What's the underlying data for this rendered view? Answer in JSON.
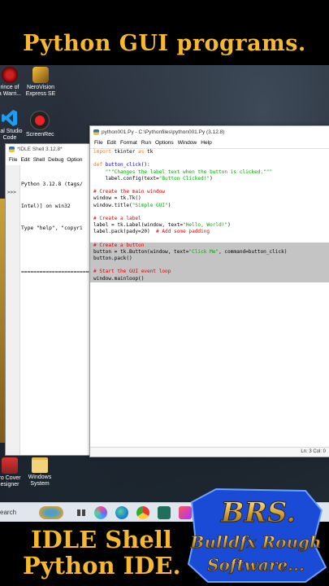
{
  "banner": {
    "top_title": "Python GUI programs.",
    "bottom_line1": "IDLE Shell",
    "bottom_line2": "Python IDE."
  },
  "desktop_icons": [
    {
      "label1": "rince of",
      "label2": "a Warri..."
    },
    {
      "label1": "NeroVision",
      "label2": "Express SE"
    },
    {
      "label1": "ual Studio",
      "label2": "Code"
    },
    {
      "label1": "ScreenRec",
      "label2": ""
    },
    {
      "label1": "ro Cover",
      "label2": "esigner"
    },
    {
      "label1": "Windows",
      "label2": "System"
    }
  ],
  "shell": {
    "title": "*IDLE Shell 3.12.8*",
    "menu": [
      "File",
      "Edit",
      "Shell",
      "Debug",
      "Option"
    ],
    "prompt": ">>>",
    "lines": [
      "Python 3.12.8 (tags/",
      "Intel)] on win32",
      "Type \"help\", \"copyri",
      "",
      "======================="
    ]
  },
  "editor": {
    "title": "python001.Py - C:\\Pythonfiles\\python001.Py (3.12.8)",
    "menu": [
      "File",
      "Edit",
      "Format",
      "Run",
      "Options",
      "Window",
      "Help"
    ],
    "status": "Ln: 3   Col: 0"
  },
  "taskbar": {
    "search_label": "earch"
  },
  "logo": {
    "text1": "BRS.",
    "text2": "Bulldfx Rough",
    "text3": "Software..."
  },
  "colors": {
    "headline": "#f5b82e",
    "keyword": "#ff7700",
    "string": "#00aa00",
    "comment": "#dd0000",
    "highlight": "#c4c4c4"
  }
}
